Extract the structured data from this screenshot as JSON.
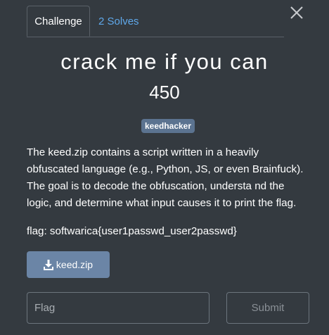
{
  "tabs": {
    "challenge_label": "Challenge",
    "solves_label": "2 Solves"
  },
  "challenge": {
    "title": "crack me if you can",
    "points": "450",
    "tag": "keedhacker",
    "description": "The keed.zip contains a script written in a heavily obfuscated language (e.g., Python, JS, or even Brainfuck). The goal is to decode the obfuscation, understa nd the logic, and determine what input causes it to print the flag.",
    "flag_format": "flag: softwarica{user1passwd_user2passwd}",
    "file_name": "keed.zip"
  },
  "form": {
    "flag_placeholder": "Flag",
    "flag_value": "",
    "submit_label": "Submit"
  },
  "icons": {
    "close": "close-icon",
    "download": "download-icon"
  },
  "colors": {
    "background": "#343a40",
    "link": "#5fa8ea",
    "tag_bg": "#5b7390",
    "download_bg": "#6b85a6"
  }
}
